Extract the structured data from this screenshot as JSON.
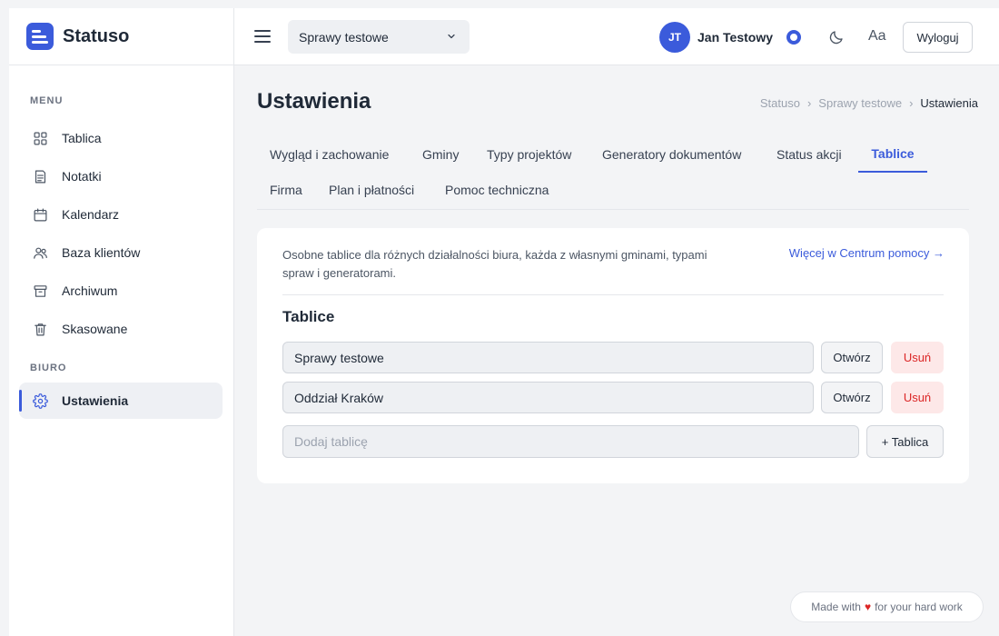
{
  "brand": {
    "name": "Statuso"
  },
  "sidebar": {
    "menu_heading": "MENU",
    "items": [
      {
        "label": "Tablica",
        "icon": "grid-icon"
      },
      {
        "label": "Notatki",
        "icon": "note-icon"
      },
      {
        "label": "Kalendarz",
        "icon": "calendar-icon"
      },
      {
        "label": "Baza klientów",
        "icon": "users-icon"
      },
      {
        "label": "Archiwum",
        "icon": "archive-icon"
      },
      {
        "label": "Skasowane",
        "icon": "trash-icon"
      }
    ],
    "biuro_heading": "BIURO",
    "biuro_items": [
      {
        "label": "Ustawienia",
        "icon": "gear-icon",
        "active": true
      }
    ]
  },
  "topbar": {
    "board_select": "Sprawy testowe",
    "user_initials": "JT",
    "user_name": "Jan Testowy",
    "font_toggle": "Aa",
    "logout_label": "Wyloguj"
  },
  "page": {
    "title": "Ustawienia",
    "breadcrumb": [
      "Statuso",
      "›",
      "Sprawy testowe",
      "›",
      "Ustawienia"
    ]
  },
  "tabs": [
    {
      "label": "Wygląd i zachowanie"
    },
    {
      "label": "Gminy"
    },
    {
      "label": "Typy projektów"
    },
    {
      "label": "Generatory dokumentów"
    },
    {
      "label": "Status akcji"
    },
    {
      "label": "Tablice",
      "active": true
    },
    {
      "label": "Firma"
    },
    {
      "label": "Plan i płatności"
    },
    {
      "label": "Pomoc techniczna"
    }
  ],
  "card": {
    "description": "Osobne tablice dla różnych działalności biura, każda z własnymi gminami, typami spraw i generatorami.",
    "help_link": "Więcej w Centrum pomocy →",
    "section_title": "Tablice",
    "boards": [
      {
        "name": "Sprawy testowe",
        "open_label": "Otwórz",
        "delete_label": "Usuń"
      },
      {
        "name": "Oddział Kraków",
        "open_label": "Otwórz",
        "delete_label": "Usuń"
      }
    ],
    "add_placeholder": "Dodaj tablicę",
    "add_button": "+ Tablica"
  },
  "footer": {
    "before": "Made with",
    "heart": "♥",
    "after": "for your hard work"
  },
  "colors": {
    "accent": "#3b5bdb",
    "danger": "#dc2626",
    "danger_bg": "#fde8e8"
  }
}
